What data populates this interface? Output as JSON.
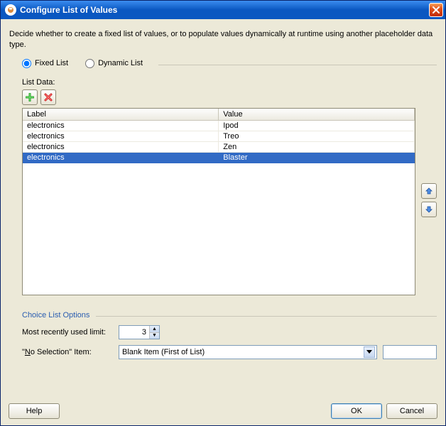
{
  "window": {
    "title": "Configure List of Values"
  },
  "description": "Decide whether to create a fixed list of values, or to populate values dynamically at runtime using another placeholder data type.",
  "mode": {
    "fixed_label": "Fixed List",
    "dynamic_label": "Dynamic List",
    "selected": "fixed"
  },
  "list_section": {
    "label": "List Data:",
    "columns": {
      "label": "Label",
      "value": "Value"
    },
    "rows": [
      {
        "label": "electronics",
        "value": "Ipod",
        "selected": false
      },
      {
        "label": "electronics",
        "value": "Treo",
        "selected": false
      },
      {
        "label": "electronics",
        "value": "Zen",
        "selected": false
      },
      {
        "label": "electronics",
        "value": "Blaster",
        "selected": true
      }
    ]
  },
  "choice_options": {
    "title": "Choice List Options",
    "mru_label": "Most recently used limit:",
    "mru_value": "3",
    "no_selection_label_pre": "\"",
    "no_selection_label_u": "N",
    "no_selection_label_post": "o Selection\" Item:",
    "no_selection_value": "Blank Item (First of List)"
  },
  "buttons": {
    "help": "Help",
    "ok": "OK",
    "cancel": "Cancel"
  },
  "icons": {
    "add": "add-icon",
    "delete": "delete-icon",
    "up": "arrow-up-icon",
    "down": "arrow-down-icon",
    "close": "close-icon",
    "dropdown": "chevron-down-icon"
  }
}
